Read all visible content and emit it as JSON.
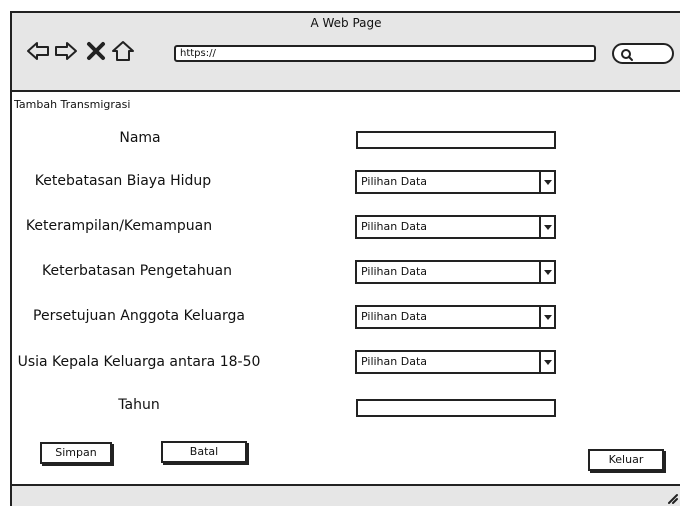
{
  "window": {
    "title": "A Web Page"
  },
  "browser": {
    "url": "https://",
    "icons": [
      "back-arrow-icon",
      "forward-arrow-icon",
      "close-x-icon",
      "home-icon",
      "search-icon"
    ]
  },
  "form": {
    "section_title": "Tambah Transmigrasi",
    "fields": [
      {
        "label": "Nama",
        "type": "text",
        "value": ""
      },
      {
        "label": "Ketebatasan Biaya Hidup",
        "type": "select",
        "value": "Pilihan Data"
      },
      {
        "label": "Keterampilan/Kemampuan",
        "type": "select",
        "value": "Pilihan Data"
      },
      {
        "label": "Keterbatasan Pengetahuan",
        "type": "select",
        "value": "Pilihan Data"
      },
      {
        "label": "Persetujuan Anggota Keluarga",
        "type": "select",
        "value": "Pilihan Data"
      },
      {
        "label": "Usia Kepala Keluarga antara 18-50",
        "type": "select",
        "value": "Pilihan Data"
      },
      {
        "label": "Tahun",
        "type": "text",
        "value": ""
      }
    ],
    "buttons": {
      "save": "Simpan",
      "cancel": "Batal",
      "exit": "Keluar"
    }
  },
  "colors": {
    "chrome": "#e6e6e6",
    "border": "#222222",
    "background": "#ffffff"
  }
}
